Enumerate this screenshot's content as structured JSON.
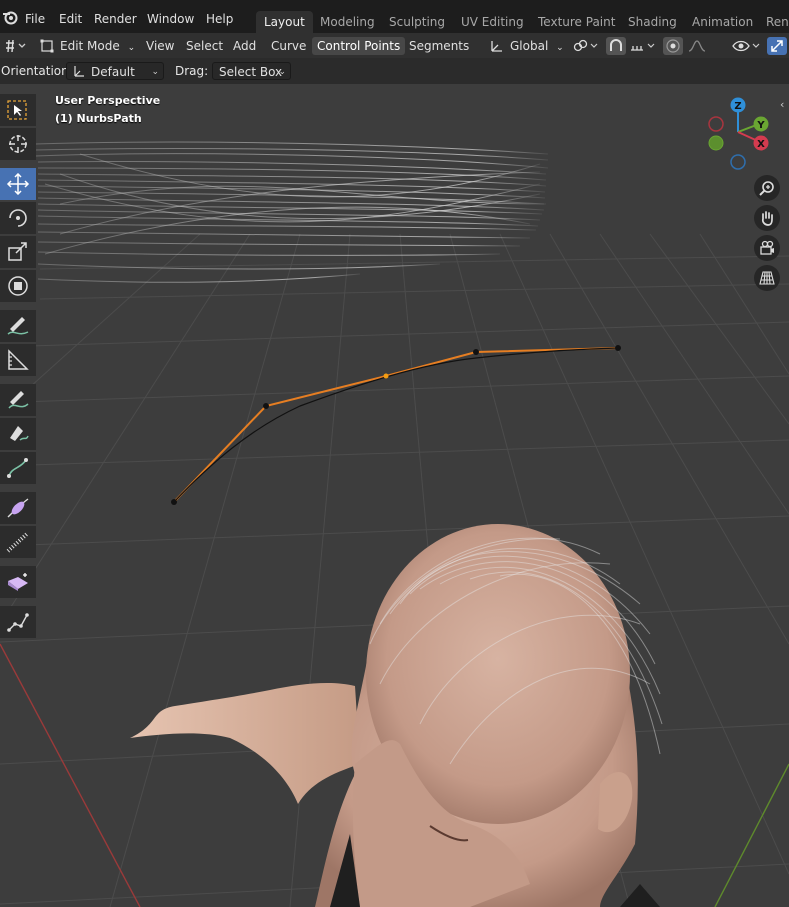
{
  "topbar": {
    "menus": [
      "File",
      "Edit",
      "Render",
      "Window",
      "Help"
    ],
    "workspaces": [
      "Layout",
      "Modeling",
      "Sculpting",
      "UV Editing",
      "Texture Paint",
      "Shading",
      "Animation",
      "Rend"
    ],
    "active_workspace": "Layout"
  },
  "header": {
    "mode": "Edit Mode",
    "menus": [
      "View",
      "Select",
      "Add",
      "Curve",
      "Control Points",
      "Segments"
    ],
    "selected_menu": "Control Points",
    "transform_orientation": "Global"
  },
  "toolsettings": {
    "orientation_label": "Orientation:",
    "orientation_value": "Default",
    "drag_label": "Drag:",
    "drag_value": "Select Box"
  },
  "viewport": {
    "view_name": "User Perspective",
    "object_name": "(1) NurbsPath",
    "gizmo_axes": [
      "Z",
      "Y",
      "X"
    ],
    "accent_color": "#4772b3",
    "curve_color": "#e67e22"
  },
  "toolbar": {
    "tools": [
      "select-box",
      "cursor",
      "move",
      "rotate",
      "scale",
      "transform",
      "annotate",
      "measure",
      "draw",
      "pen",
      "curve-pen",
      "tilt",
      "radius",
      "extrude",
      "randomize"
    ],
    "active_tool": "move"
  },
  "navigation": {
    "buttons": [
      "zoom",
      "pan",
      "camera",
      "perspective-toggle"
    ]
  }
}
